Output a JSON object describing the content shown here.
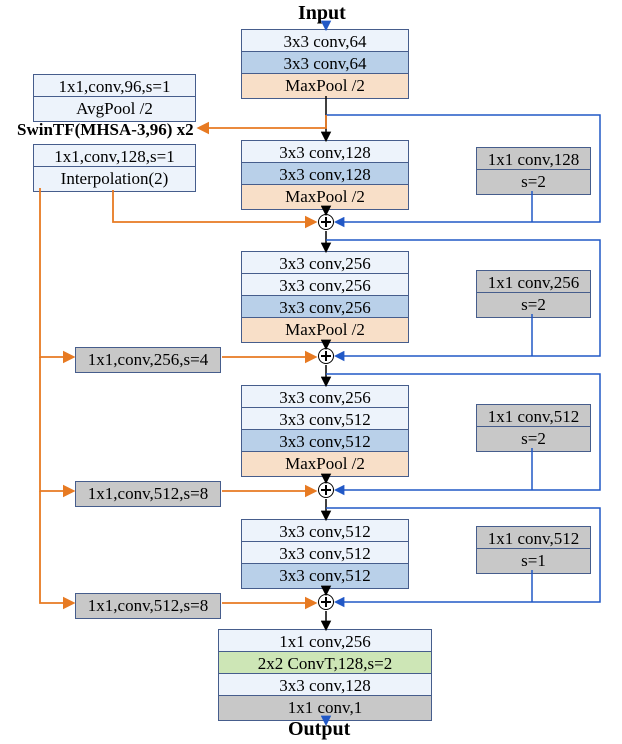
{
  "io": {
    "input": "Input",
    "output": "Output"
  },
  "side": {
    "r1": "1x1,conv,96,s=1",
    "r2": "AvgPool /2",
    "swin": "SwinTF(MHSA-3,96) x2",
    "r4": "1x1,conv,128,s=1",
    "r5": "Interpolation(2)"
  },
  "proj": {
    "p256": "1x1,conv,256,s=4",
    "p512a": "1x1,conv,512,s=8",
    "p512b": "1x1,conv,512,s=8"
  },
  "main": {
    "b1": {
      "l1": "3x3 conv,64",
      "l2": "3x3 conv,64",
      "mp": "MaxPool /2"
    },
    "b2": {
      "l1": "3x3 conv,128",
      "l2": "3x3 conv,128",
      "mp": "MaxPool /2"
    },
    "b3": {
      "l1": "3x3 conv,256",
      "l2": "3x3 conv,256",
      "l3": "3x3 conv,256",
      "mp": "MaxPool /2"
    },
    "b4": {
      "l1": "3x3 conv,256",
      "l2": "3x3 conv,512",
      "l3": "3x3 conv,512",
      "mp": "MaxPool /2"
    },
    "b5": {
      "l1": "3x3 conv,512",
      "l2": "3x3 conv,512",
      "l3": "3x3 conv,512"
    },
    "out": {
      "l1": "1x1 conv,256",
      "l2": "2x2 ConvT,128,s=2",
      "l3": "3x3 conv,128",
      "l4": "1x1 conv,1"
    }
  },
  "skip": {
    "s128": {
      "l1": "1x1 conv,128",
      "l2": "s=2"
    },
    "s256": {
      "l1": "1x1 conv,256",
      "l2": "s=2"
    },
    "s512a": {
      "l1": "1x1 conv,512",
      "l2": "s=2"
    },
    "s512b": {
      "l1": "1x1 conv,512",
      "l2": "s=1"
    }
  }
}
